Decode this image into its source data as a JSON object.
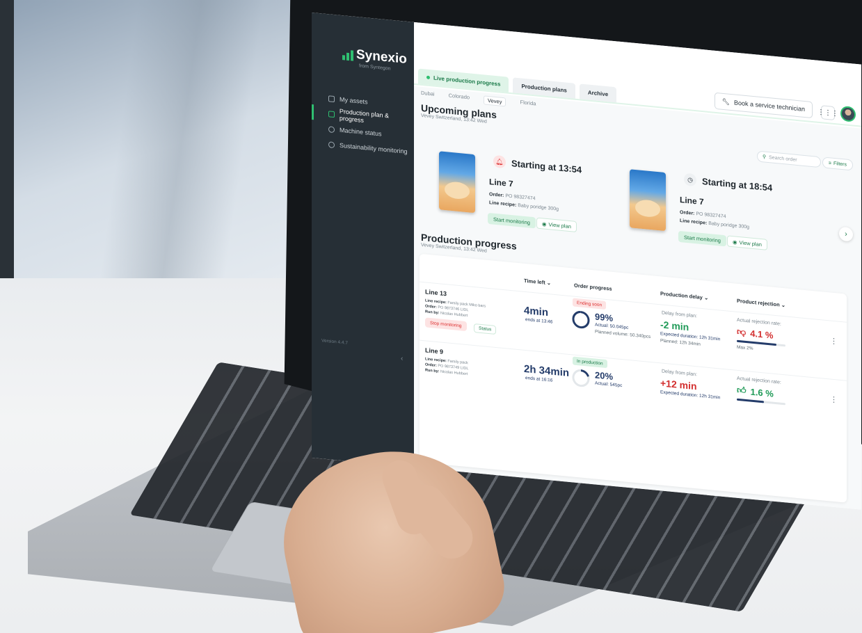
{
  "app": {
    "brand": "Synexio",
    "brand_sub": "from Syntegon"
  },
  "sidebar": {
    "items": [
      {
        "label": "My assets",
        "icon": "assets-icon",
        "active": false
      },
      {
        "label": "Production plan & progress",
        "icon": "chart-line-icon",
        "active": true
      },
      {
        "label": "Machine status",
        "icon": "gauge-icon",
        "active": false
      },
      {
        "label": "Sustainability monitoring",
        "icon": "leaf-icon",
        "active": false
      }
    ],
    "version": "Version 4.4.7"
  },
  "header": {
    "service_button": "Book a service technician"
  },
  "tabs": [
    "Live production progress",
    "Production plans",
    "Archive"
  ],
  "sites": [
    "Dubai",
    "Colorado",
    "Vevey",
    "Florida"
  ],
  "upcoming": {
    "title": "Upcoming plans",
    "subtitle": "Vevey Switzerland, 13:42 Wed",
    "search_placeholder": "Search order",
    "filters_label": "Filters",
    "plans": [
      {
        "start": "Starting at 13:54",
        "line": "Line 7",
        "order_label": "Order:",
        "order": "PO 98327474",
        "recipe_label": "Line recipe:",
        "recipe": "Baby poridge 300g",
        "start_btn": "Start monitoring",
        "view_btn": "View plan"
      },
      {
        "start": "Starting at 18:54",
        "line": "Line 7",
        "order_label": "Order:",
        "order": "PO 98327474",
        "recipe_label": "Line recipe:",
        "recipe": "Baby poridge 300g",
        "start_btn": "Start monitoring",
        "view_btn": "View plan"
      }
    ]
  },
  "progress": {
    "title": "Production progress",
    "subtitle": "Vevey Switzerland, 13:42 Wed",
    "columns": {
      "time_left": "Time left",
      "order_progress": "Order progress",
      "production_delay": "Production delay",
      "product_rejection": "Product rejection"
    },
    "rows": [
      {
        "line": "Line 13",
        "recipe_label": "Line recipe:",
        "recipe": "Family pack Miko bars",
        "order_label": "Order:",
        "order": "PO 9873746 LIDL",
        "run_label": "Run by:",
        "run_by": "Nicolas Hubbert",
        "action": "Stop monitoring",
        "status": "Status",
        "time_left": "4min",
        "time_sub": "ends at 13:46",
        "badge": "Ending soon",
        "progress_pct": "99%",
        "progress_value": 0.99,
        "actual": "Actual: 50.045pc",
        "planned": "Planned volume: 50.340pcs",
        "delay_label": "Delay from plan:",
        "delay": "-2 min",
        "delay_color": "#1f9a57",
        "expected": "Expected duration: 12h 31min",
        "planned_dur": "Planned: 12h 34min",
        "rej_label": "Actual rejection rate:",
        "rej": "4.1 %",
        "rej_color": "#d32f2f",
        "rej_value": 0.82,
        "rej_max": "Max 2%"
      },
      {
        "line": "Line 9",
        "recipe_label": "Line recipe:",
        "recipe": "Family pack",
        "order_label": "Order:",
        "order": "PO 9873749 LIDL",
        "run_label": "Run by:",
        "run_by": "Nicolas Hubbert",
        "action": "",
        "status": "",
        "time_left": "2h 34min",
        "time_sub": "ends at 16:16",
        "badge": "In production",
        "progress_pct": "20%",
        "progress_value": 0.2,
        "actual": "Actual: 545pc",
        "planned": "",
        "delay_label": "Delay from plan:",
        "delay": "+12 min",
        "delay_color": "#d32f2f",
        "expected": "Expected duration: 12h 31min",
        "planned_dur": "",
        "rej_label": "Actual rejection rate:",
        "rej": "1.6 %",
        "rej_color": "#1f9a57",
        "rej_value": 0.55,
        "rej_max": ""
      }
    ]
  }
}
